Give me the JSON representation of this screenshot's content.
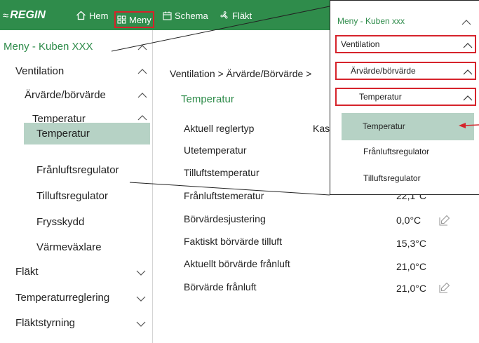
{
  "topbar": {
    "brand": "REGIN",
    "nav": {
      "home": "Hem",
      "menu": "Meny",
      "schema": "Schema",
      "fan": "Fläkt"
    },
    "icons": {
      "home": "home-icon",
      "menu": "grid-icon",
      "schema": "calendar-icon",
      "fan": "fan-icon"
    }
  },
  "sidebar": {
    "header": "Meny - Kuben XXX",
    "items": {
      "ventilation": "Ventilation",
      "actual_setpoint": "Ärvärde/börvärde",
      "temperature_group": "Temperatur",
      "temperature": "Temperatur",
      "exhaust_regulator": "Frånluftsregulator",
      "supply_regulator": "Tilluftsregulator",
      "frost_protection": "Frysskydd",
      "heat_exchanger": "Värmeväxlare",
      "fan": "Fläkt",
      "temperature_control": "Temperaturreglering",
      "fan_control": "Fläktstyrning"
    }
  },
  "main": {
    "breadcrumb": "Ventilation > Ärvärde/Börvärde >",
    "section_title": "Temperatur",
    "rows": {
      "control_type": {
        "label": "Aktuell reglertyp",
        "value": "Kas"
      },
      "outdoor_temp": {
        "label": "Utetemperatur",
        "value": ""
      },
      "supply_temp": {
        "label": "Tilluftstemperatur",
        "value": ""
      },
      "exhaust_temp": {
        "label": "Frånluftstemeratur",
        "value": "22,1°C"
      },
      "setpoint_adjust": {
        "label": "Börvärdesjustering",
        "value": "0,0°C"
      },
      "actual_setpoint_supply": {
        "label": "Faktiskt börvärde tilluft",
        "value": "15,3°C"
      },
      "current_setpoint_exhaust": {
        "label": "Aktuellt börvärde frånluft",
        "value": "21,0°C"
      },
      "setpoint_exhaust": {
        "label": "Börvärde frånluft",
        "value": "21,0°C"
      }
    }
  },
  "callout": {
    "header": "Meny - Kuben xxx",
    "ventilation": "Ventilation",
    "actual_setpoint": "Ärvärde/börvärde",
    "temperature_group": "Temperatur",
    "temperature": "Temperatur",
    "exhaust_regulator": "Frånluftsregulator",
    "supply_regulator": "Tilluftsregulator"
  },
  "colors": {
    "brand_green": "#2f8c4b",
    "selection": "#b6d2c5",
    "highlight_red": "#d6232b"
  }
}
